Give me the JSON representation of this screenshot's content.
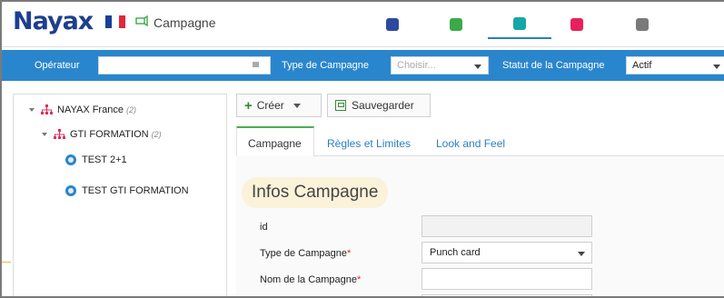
{
  "header": {
    "logo_text": "Nayax",
    "title": "Campagne",
    "app_tabs": [
      {
        "icon": "dashboard-icon",
        "color": "#2d4aa0"
      },
      {
        "icon": "device-icon",
        "color": "#3aaa4a"
      },
      {
        "icon": "campaign-icon",
        "color": "#16a6a6",
        "active": true
      },
      {
        "icon": "alert-icon",
        "color": "#e8215d"
      },
      {
        "icon": "tools-icon",
        "color": "#7a7a7a"
      }
    ]
  },
  "filter_bar": {
    "operator_label": "Opérateur",
    "operator_value": "",
    "campaign_type_label": "Type de Campagne",
    "campaign_type_placeholder": "Choisir...",
    "campaign_status_label": "Statut de la Campagne",
    "campaign_status_value": "Actif"
  },
  "tree": {
    "items": [
      {
        "label": "NAYAX France",
        "count": "(2)"
      },
      {
        "label": "GTI FORMATION",
        "count": "(2)"
      },
      {
        "label": "TEST 2+1"
      },
      {
        "label": "TEST GTI FORMATION"
      }
    ]
  },
  "toolbar": {
    "create_label": "Créer",
    "save_label": "Sauvegarder"
  },
  "tabs": [
    {
      "label": "Campagne",
      "active": true
    },
    {
      "label": "Règles et Limites"
    },
    {
      "label": "Look and Feel"
    }
  ],
  "form": {
    "section_title": "Infos Campagne",
    "fields": {
      "id_label": "id",
      "id_value": "",
      "type_label": "Type de Campagne",
      "type_value": "Punch card",
      "name_label": "Nom de la Campagne",
      "name_value": "",
      "required_mark": "*"
    }
  },
  "colors": {
    "filter_bar": "#2a86cc",
    "brand": "#1c3f8f",
    "active_tab_accent": "#4caf50",
    "section_highlight": "#fbf3d9"
  }
}
